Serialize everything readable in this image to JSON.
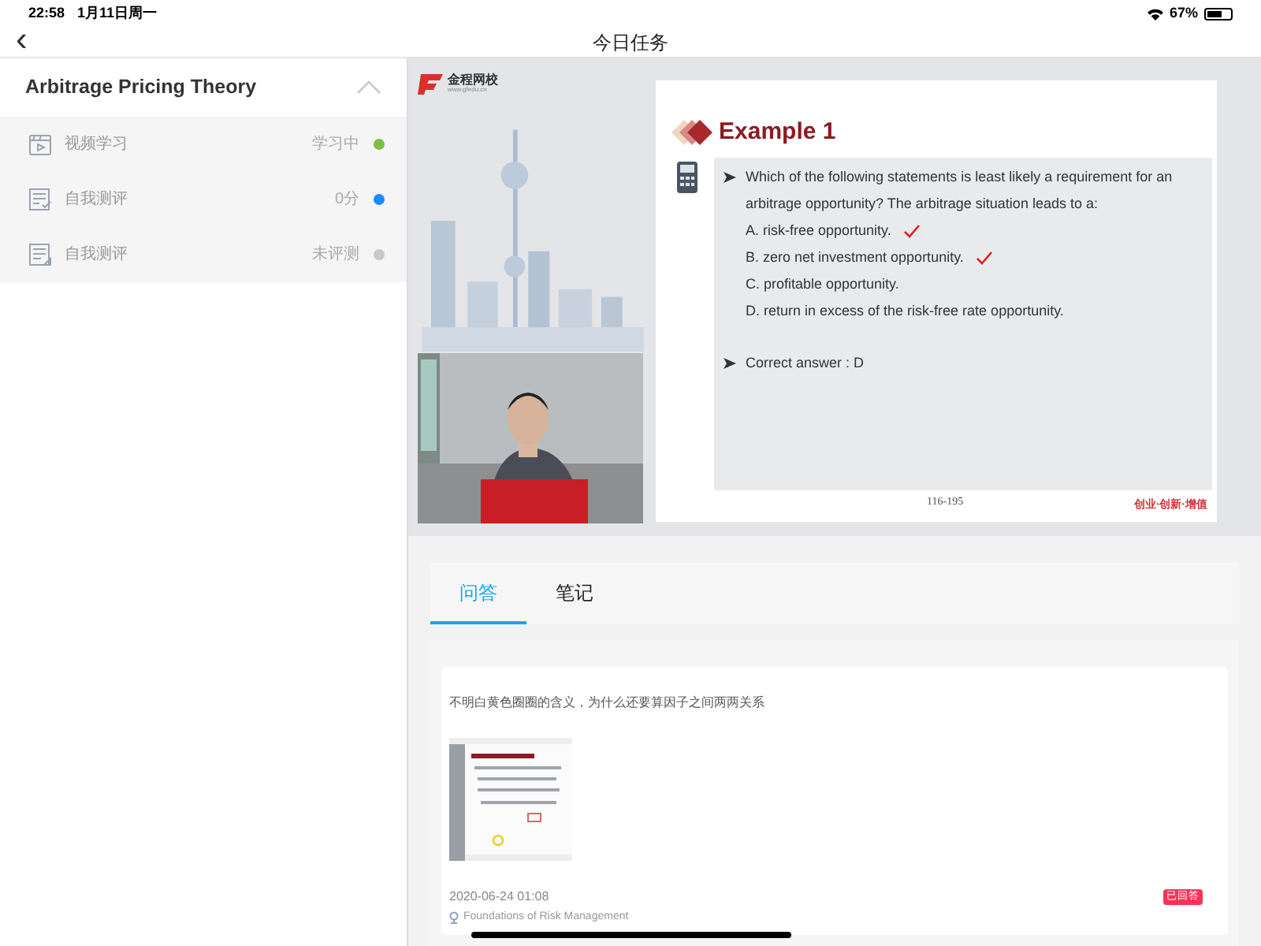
{
  "status_bar": {
    "time": "22:58",
    "date": "1月11日周一",
    "battery": "67%"
  },
  "nav": {
    "back": "‹",
    "title": "今日任务"
  },
  "chapter": {
    "title": "Arbitrage Pricing Theory",
    "expanded": true,
    "items": [
      {
        "kind": "video",
        "label": "视频学习",
        "status": "学习中",
        "color": "#7ac143"
      },
      {
        "kind": "quiz",
        "label": "自我测评",
        "status": "0分",
        "color": "#1a8cff"
      },
      {
        "kind": "exam",
        "label": "自我测评",
        "status": "未评测",
        "color": "#c8c8c8"
      }
    ]
  },
  "video": {
    "logo": "金程网校",
    "logo_url": "www.gfedu.cn",
    "slide": {
      "title": "Example 1",
      "question": "Which of the following statements is least likely a requirement for an arbitrage opportunity? The arbitrage situation leads to a:",
      "options": [
        {
          "text": "A. risk-free opportunity.",
          "marked": true
        },
        {
          "text": "B. zero net investment opportunity.",
          "marked": true
        },
        {
          "text": "C. profitable opportunity.",
          "marked": false
        },
        {
          "text": "D. return in excess of the risk-free rate opportunity.",
          "marked": false
        }
      ],
      "answer": "Correct answer : D",
      "page": "116-195",
      "slogan": "创业·创新·增值"
    }
  },
  "tabs": [
    {
      "label": "问答",
      "selected": true
    },
    {
      "label": "笔记",
      "selected": false
    }
  ],
  "questions": [
    {
      "text": "不明白黄色圈圈的含义，为什么还要算因子之间两两关系",
      "date": "2020-06-24 01:08",
      "course": "Foundations of Risk Management",
      "badge": "已回答"
    }
  ]
}
